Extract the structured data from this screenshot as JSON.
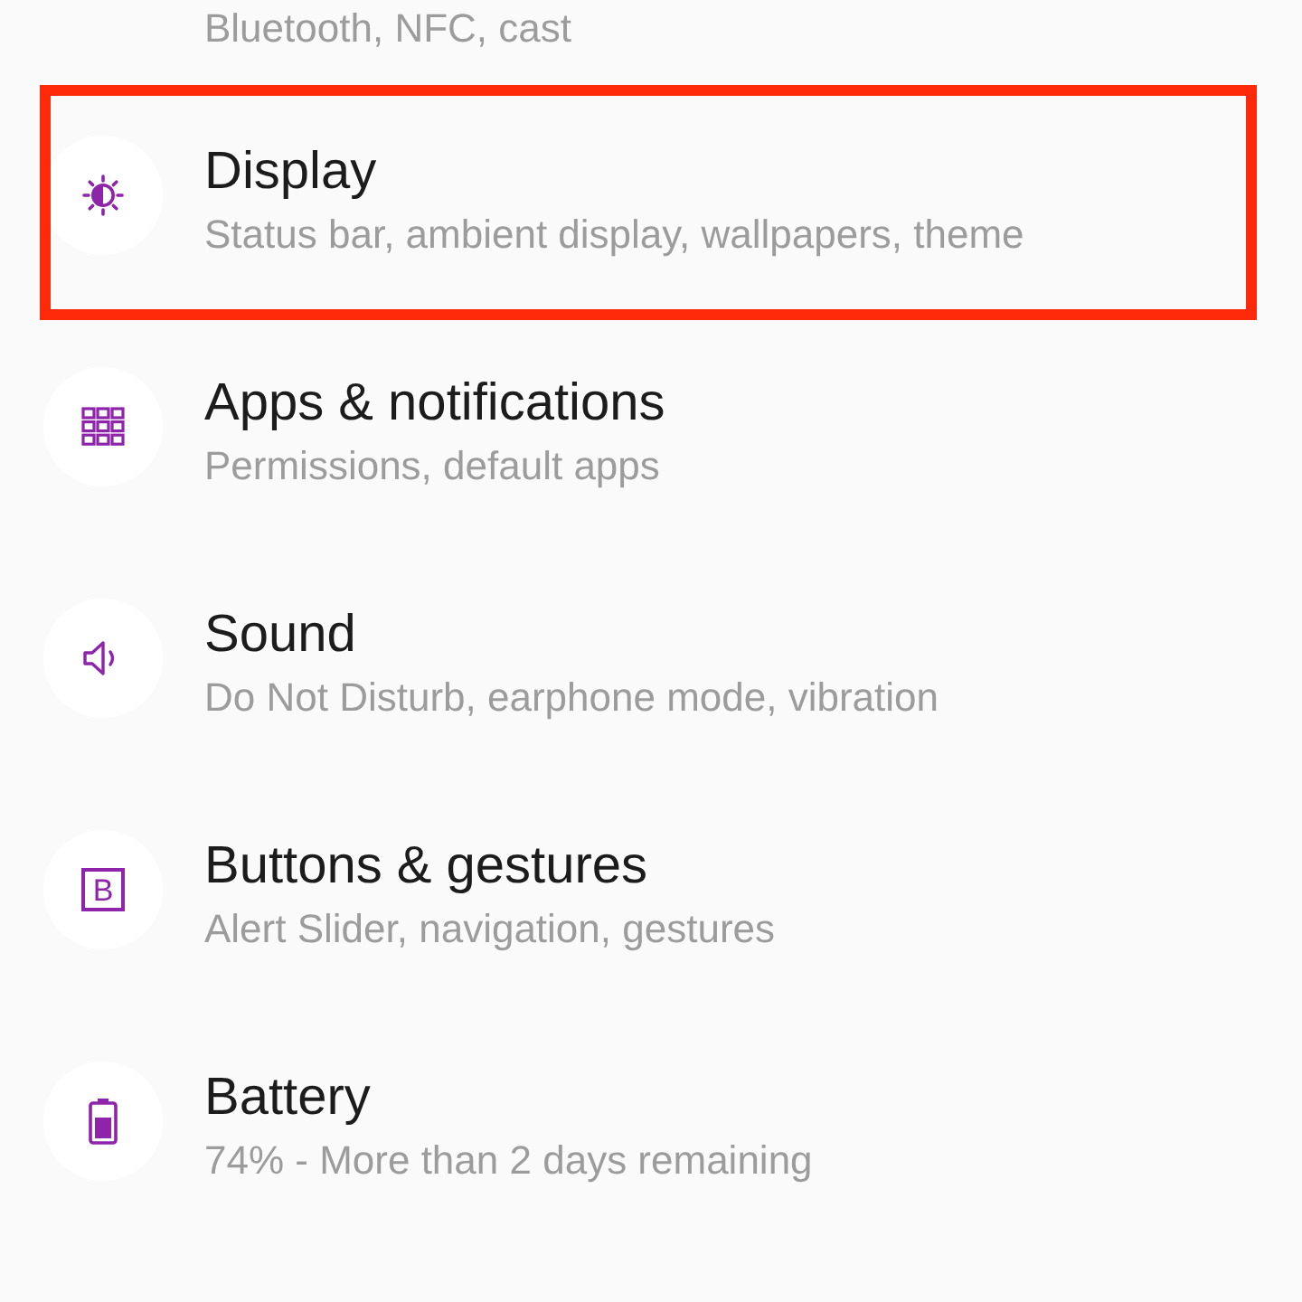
{
  "settings_list": {
    "items": [
      {
        "subtitle": "Bluetooth, NFC, cast",
        "highlighted": false
      },
      {
        "title": "Display",
        "subtitle": "Status bar, ambient display, wallpapers, theme",
        "highlighted": true
      },
      {
        "title": "Apps & notifications",
        "subtitle": "Permissions, default apps",
        "highlighted": false
      },
      {
        "title": "Sound",
        "subtitle": "Do Not Disturb, earphone mode, vibration",
        "highlighted": false
      },
      {
        "title": "Buttons & gestures",
        "subtitle": "Alert Slider, navigation, gestures",
        "icon_letter": "B",
        "highlighted": false
      },
      {
        "title": "Battery",
        "subtitle": "74% - More than 2 days remaining",
        "highlighted": false
      }
    ]
  }
}
